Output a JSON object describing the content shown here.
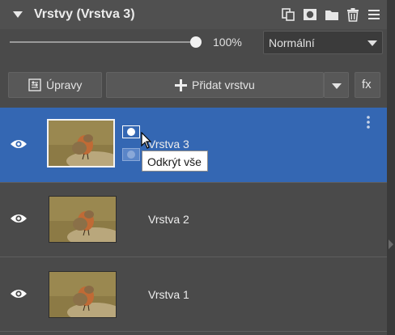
{
  "header": {
    "title": "Vrstvy (Vrstva 3)",
    "icons": [
      "duplicate-icon",
      "mask-icon",
      "folder-icon",
      "trash-icon",
      "menu-icon"
    ]
  },
  "opacity": {
    "value_label": "100%",
    "value": 1.0
  },
  "blend_mode": {
    "selected": "Normální"
  },
  "toolbar": {
    "adjustments_label": "Úpravy",
    "add_layer_label": "Přidat vrstvu",
    "fx_label": "fx"
  },
  "layers": [
    {
      "name": "Vrstva 3",
      "selected": true,
      "visible": true,
      "has_mask": true
    },
    {
      "name": "Vrstva 2",
      "selected": false,
      "visible": true,
      "has_mask": false
    },
    {
      "name": "Vrstva 1",
      "selected": false,
      "visible": true,
      "has_mask": false
    }
  ],
  "tooltip": {
    "text": "Odkrýt vše"
  },
  "colors": {
    "selected_row": "#3467b3",
    "panel_bg": "#4a4a4a",
    "header_bg": "#505050"
  }
}
